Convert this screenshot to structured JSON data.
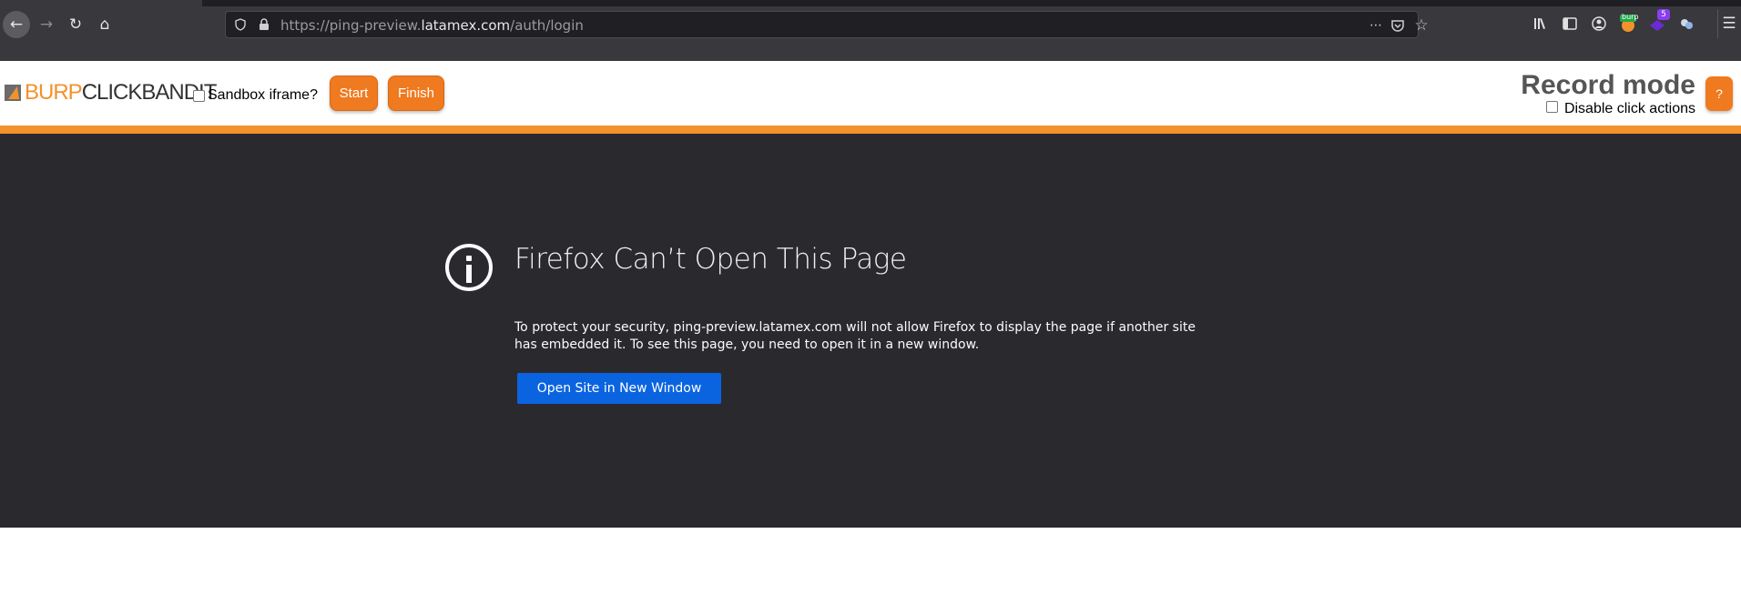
{
  "browser": {
    "url": {
      "scheme": "https://",
      "subdomain": "ping-preview.",
      "host": "latamex.com",
      "path": "/auth/login"
    },
    "extension_badge": "5",
    "extension_burp_label": "burp"
  },
  "clickbandit": {
    "logo_burp": "BURP",
    "logo_rest": "CLICKBANDIT",
    "sandbox_label": "Sandbox iframe?",
    "start_label": "Start",
    "finish_label": "Finish",
    "mode_title": "Record mode",
    "disable_label": "Disable click actions",
    "help_label": "?"
  },
  "error_page": {
    "title": "Firefox Can’t Open This Page",
    "message": "To protect your security, ping-preview.latamex.com will not allow Firefox to display the page if another site has embedded it. To see this page, you need to open it in a new window.",
    "button_label": "Open Site in New Window"
  },
  "colors": {
    "accent_orange": "#f2922c",
    "button_orange": "#f07a1f",
    "chrome_dark": "#38383d",
    "page_dark": "#2a2a2e",
    "primary_blue": "#0a64e0"
  }
}
